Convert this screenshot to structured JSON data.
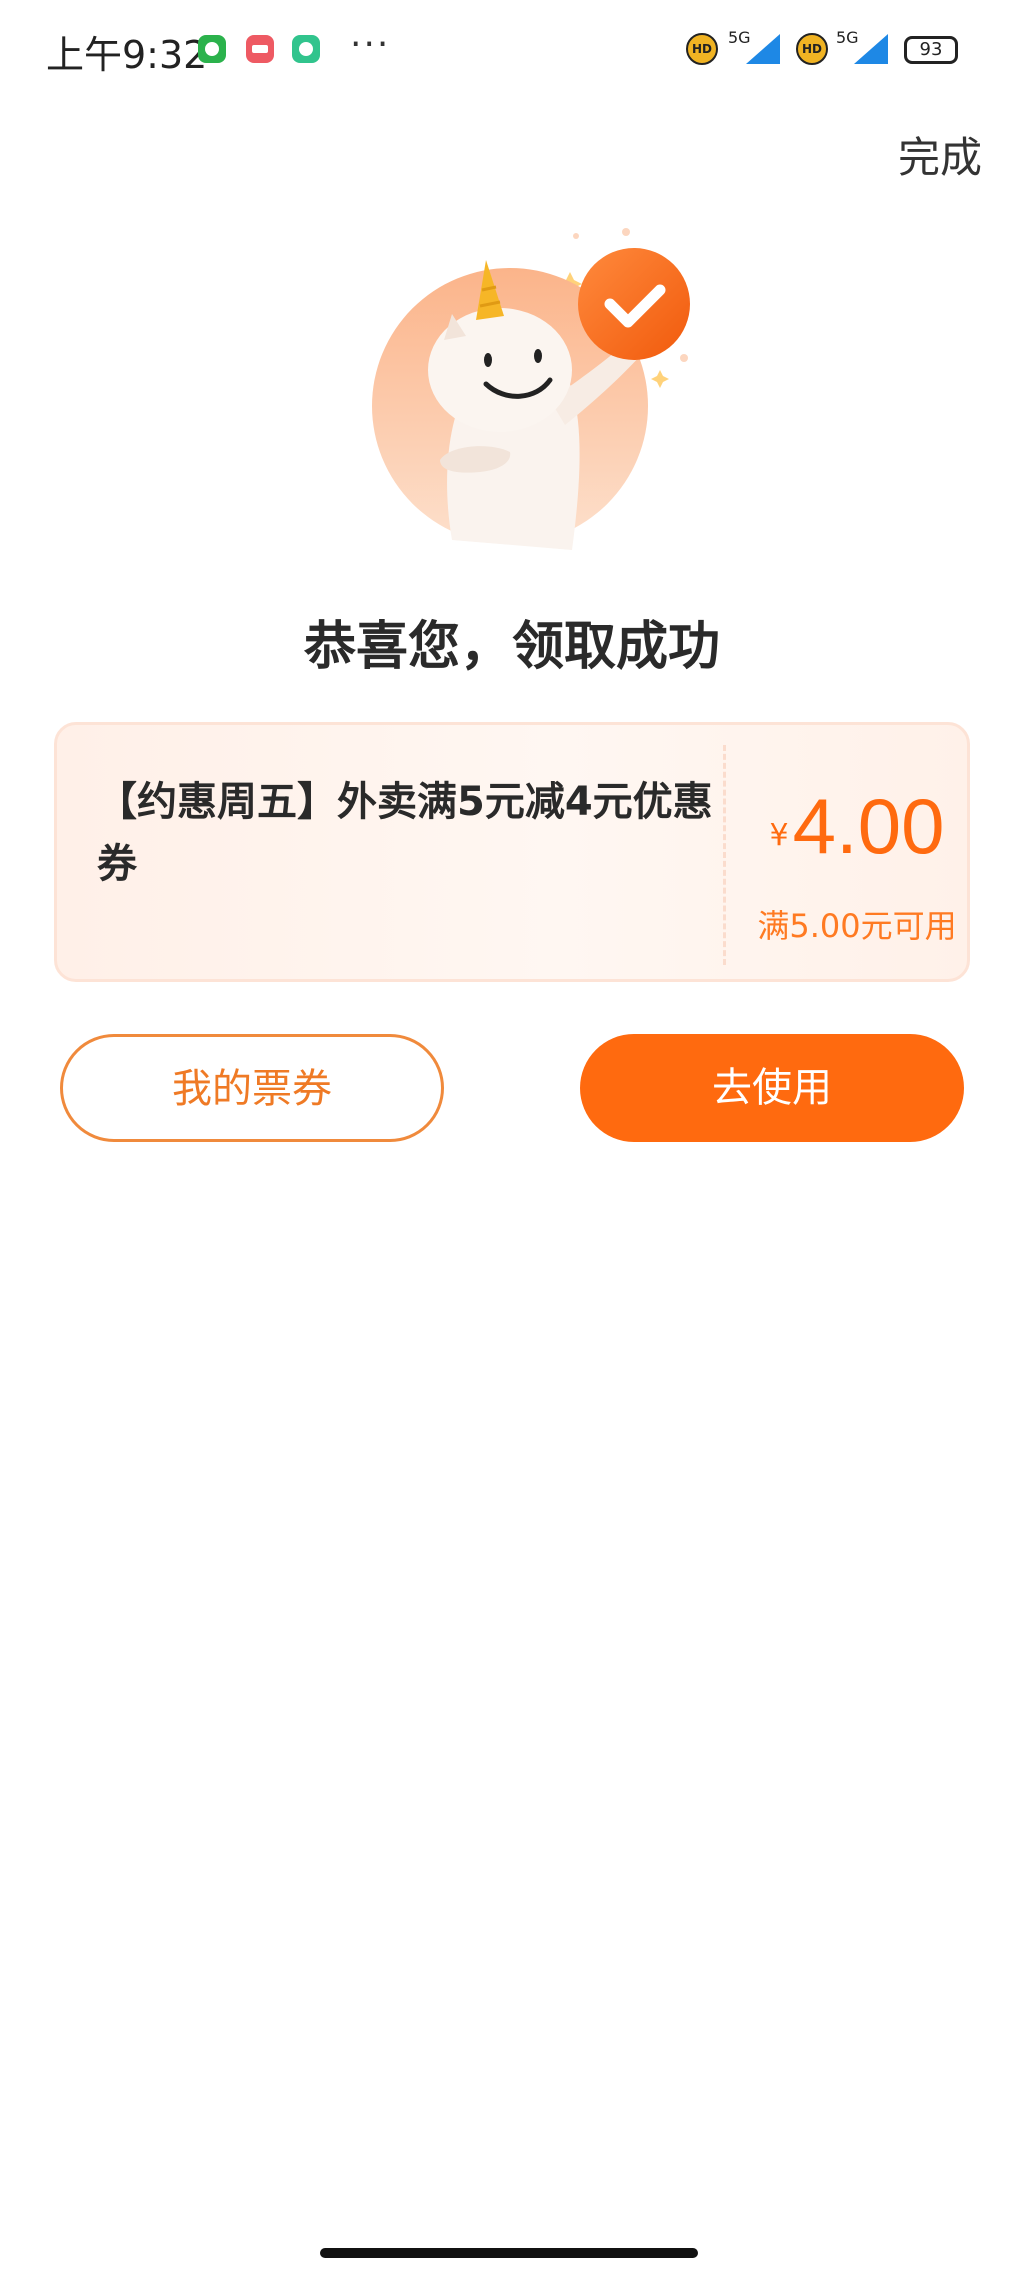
{
  "status_bar": {
    "time": "上午9:32",
    "more": "···",
    "hd_1": "HD",
    "network_1": "5G",
    "hd_2": "HD",
    "network_2": "5G",
    "battery": "93"
  },
  "header": {
    "done_label": "完成"
  },
  "result": {
    "title": "恭喜您，领取成功"
  },
  "coupon": {
    "name": "【约惠周五】外卖满5元减4元优惠券",
    "currency": "¥",
    "value": "4.00",
    "threshold": "满5.00元可用"
  },
  "actions": {
    "my_tickets_label": "我的票券",
    "use_label": "去使用"
  },
  "colors": {
    "accent": "#ff6a0f",
    "card_bg": "#fff3ec",
    "title_text": "#2a2a2a"
  }
}
